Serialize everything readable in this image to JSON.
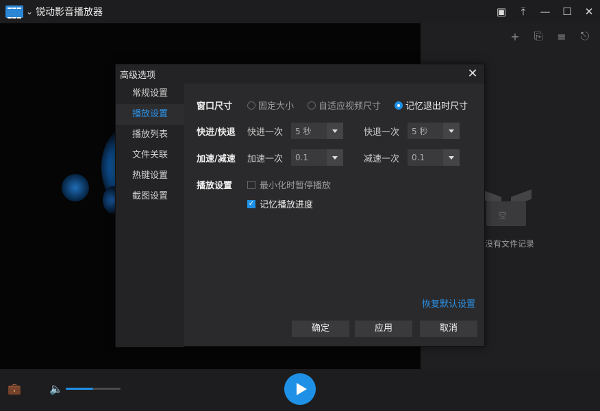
{
  "app": {
    "title": "锐动影音播放器"
  },
  "window_buttons": [
    "pip-icon",
    "pin-icon",
    "minimize-icon",
    "maximize-icon",
    "close-icon"
  ],
  "playlist": {
    "tools": [
      "add-icon",
      "remove-icon",
      "list-mode-icon",
      "clear-icon"
    ],
    "empty_box_label": "空",
    "empty_text": "没有文件记录"
  },
  "player": {
    "volume_level": 0.5,
    "accent_color": "#1e90e6"
  },
  "dialog": {
    "title": "高级选项",
    "nav": [
      {
        "label": "常规设置",
        "active": false
      },
      {
        "label": "播放设置",
        "active": true
      },
      {
        "label": "播放列表",
        "active": false
      },
      {
        "label": "文件关联",
        "active": false
      },
      {
        "label": "热键设置",
        "active": false
      },
      {
        "label": "截图设置",
        "active": false
      }
    ],
    "window_size": {
      "label": "窗口尺寸",
      "options": [
        {
          "label": "固定大小",
          "selected": false
        },
        {
          "label": "自适应视频尺寸",
          "selected": false
        },
        {
          "label": "记忆退出时尺寸",
          "selected": true
        }
      ]
    },
    "seek": {
      "label": "快进/快退",
      "forward_label": "快进一次",
      "forward_value": "5 秒",
      "backward_label": "快退一次",
      "backward_value": "5 秒"
    },
    "speed": {
      "label": "加速/减速",
      "up_label": "加速一次",
      "up_value": "0.1",
      "down_label": "减速一次",
      "down_value": "0.1"
    },
    "playback": {
      "label": "播放设置",
      "pause_on_minimize": {
        "label": "最小化时暂停播放",
        "checked": false
      },
      "remember_progress": {
        "label": "记忆播放进度",
        "checked": true
      }
    },
    "restore_defaults": "恢复默认设置",
    "buttons": {
      "ok": "确定",
      "apply": "应用",
      "cancel": "取消"
    }
  }
}
